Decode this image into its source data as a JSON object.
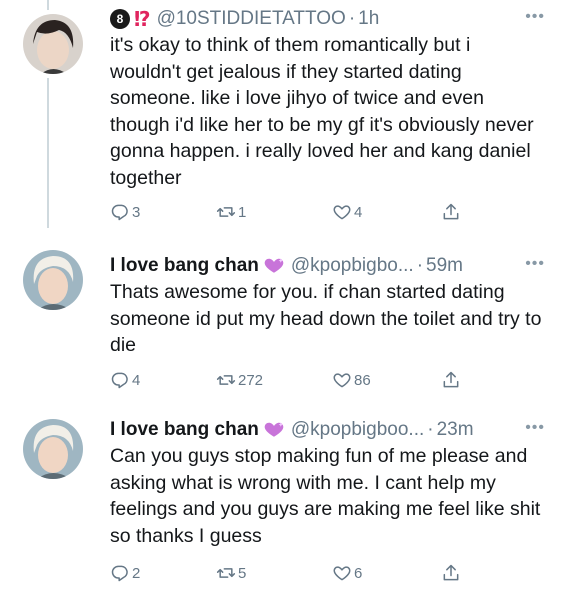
{
  "tweets": [
    {
      "name": "",
      "handle": "@10STIDDIETATTOO",
      "time": "1h",
      "prefix_badge": "8",
      "prefix_mark": "⁉",
      "text": "it's okay to think of them romantically but i wouldn't get jealous if they started dating someone. like i love jihyo of twice and even though i'd like her to be my gf it's obviously never gonna happen. i really loved her and kang daniel together",
      "replies": "3",
      "retweets": "1",
      "likes": "4"
    },
    {
      "name": "I love bang chan",
      "handle": "@kpopbigbo...",
      "time": "59m",
      "text": "Thats awesome for you. if chan started dating someone id put my head down the toilet and try to die",
      "replies": "4",
      "retweets": "272",
      "likes": "86"
    },
    {
      "name": "I love bang chan",
      "handle": "@kpopbigboo...",
      "time": "23m",
      "text": "Can you guys stop making fun of me please and asking what is wrong with me. I cant help my feelings and you guys are making me feel like shit so thanks I guess",
      "replies": "2",
      "retweets": "5",
      "likes": "6"
    }
  ],
  "colors": {
    "text": "#14171a",
    "secondary": "#657786",
    "thread_line": "#cfd9de",
    "heart_emoji": "#c874d9"
  },
  "icons": {
    "more": "more-horizontal-icon",
    "reply": "reply-icon",
    "retweet": "retweet-icon",
    "like": "heart-icon",
    "share": "share-icon"
  },
  "more_glyph": "•••"
}
